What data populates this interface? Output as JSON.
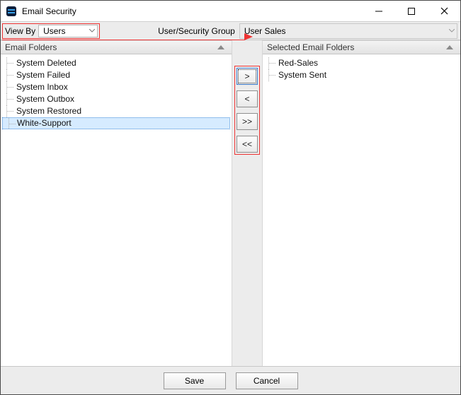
{
  "window": {
    "title": "Email Security"
  },
  "filter": {
    "view_by_label": "View By",
    "view_by_value": "Users",
    "usg_label": "User/Security Group",
    "usg_value": "User Sales"
  },
  "panels": {
    "left_header": "Email Folders",
    "right_header": "Selected Email Folders"
  },
  "left_items": {
    "0": "System Deleted",
    "1": "System Failed",
    "2": "System Inbox",
    "3": "System Outbox",
    "4": "System Restored",
    "5": "White-Support"
  },
  "right_items": {
    "0": "Red-Sales",
    "1": "System Sent"
  },
  "move": {
    "add": ">",
    "remove": "<",
    "add_all": ">>",
    "remove_all": "<<"
  },
  "footer": {
    "save": "Save",
    "cancel": "Cancel"
  }
}
